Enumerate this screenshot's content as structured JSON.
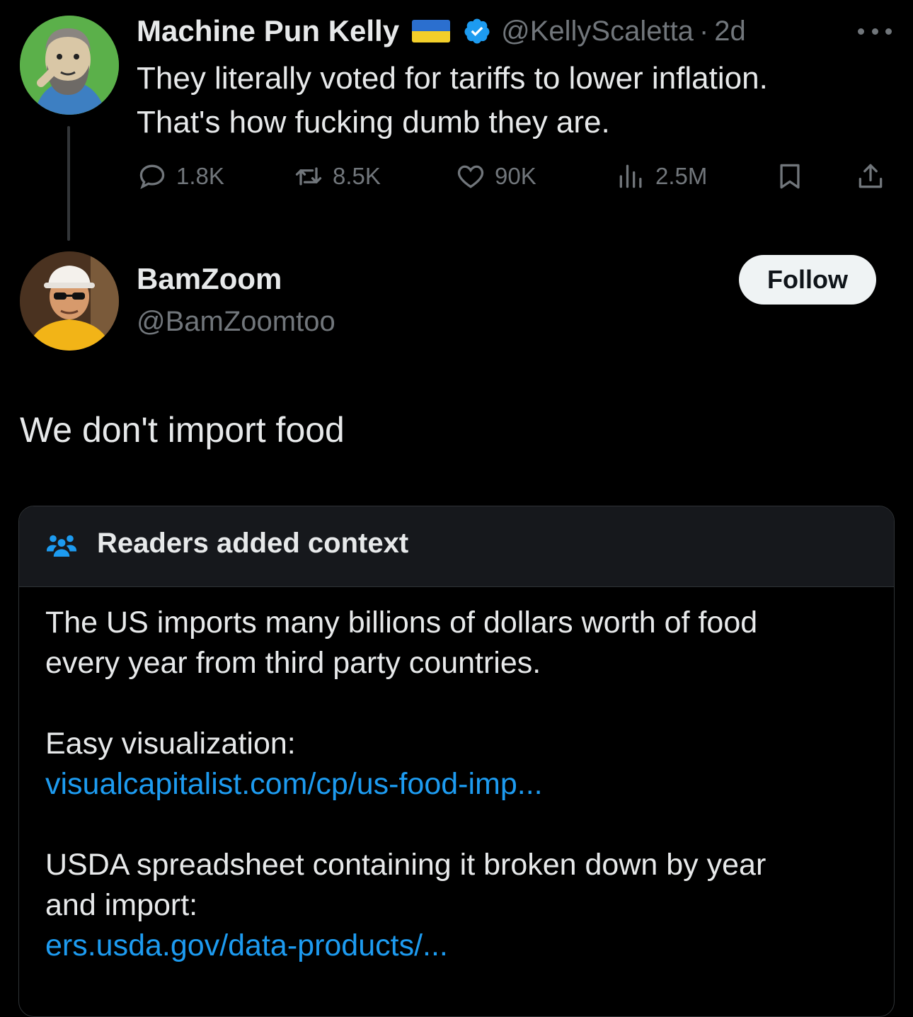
{
  "tweet1": {
    "display_name": "Machine Pun Kelly",
    "handle": "@KellyScaletta",
    "separator": "·",
    "time": "2d",
    "text_lines": [
      "They literally voted for tariffs to lower inflation.",
      "That's how fucking dumb they are."
    ],
    "actions": {
      "replies": "1.8K",
      "reposts": "8.5K",
      "likes": "90K",
      "views": "2.5M"
    },
    "icons": [
      "ukraine-flag-icon",
      "verified-badge-icon",
      "more-icon",
      "reply-icon",
      "repost-icon",
      "like-icon",
      "views-icon",
      "bookmark-icon",
      "share-icon"
    ]
  },
  "tweet2": {
    "display_name": "BamZoom",
    "handle": "@BamZoomtoo",
    "follow_label": "Follow",
    "text": "We don't import food"
  },
  "community_note": {
    "title": "Readers added context",
    "paragraph1_lines": [
      "The US imports many billions of dollars worth of food",
      "every year from third party countries."
    ],
    "paragraph2_text": "Easy visualization:",
    "link1": "visualcapitalist.com/cp/us-food-imp...",
    "paragraph3_lines": [
      "USDA spreadsheet containing it broken down by year",
      "and import:"
    ],
    "link2": "ers.usda.gov/data-products/..."
  },
  "colors": {
    "background": "#000000",
    "primary_text": "#e7e9ea",
    "secondary_text": "#71767b",
    "link": "#1d9bf0",
    "verified": "#1d9bf0",
    "note_header_bg": "#16181c",
    "border": "#2f3336"
  }
}
